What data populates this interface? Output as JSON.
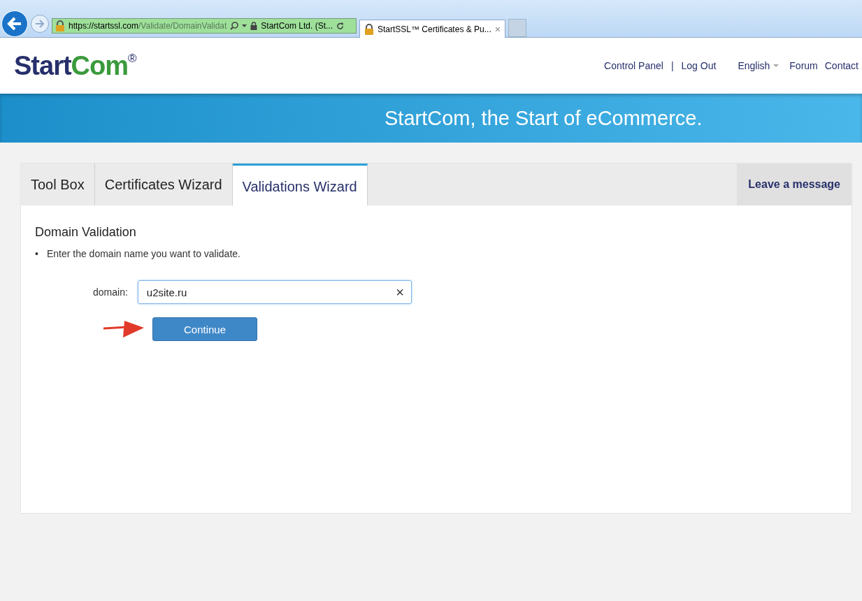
{
  "browser": {
    "url_host": "https://startssl.com",
    "url_path": "/Validate/DomainValidat",
    "site_identity": "StartCom Ltd. (St...",
    "tabs": [
      {
        "title": "StartSSL™ Certificates & Pu...",
        "selected": true,
        "close": "×"
      }
    ]
  },
  "header": {
    "logo": {
      "first": "Start",
      "second": "Com",
      "mark": "®"
    },
    "nav": [
      {
        "kind": "link",
        "label": "Control Panel"
      },
      {
        "kind": "separator",
        "label": "|"
      },
      {
        "kind": "link",
        "label": "Log Out"
      },
      {
        "kind": "dropdown",
        "label": "English"
      },
      {
        "kind": "link",
        "label": "Forum"
      },
      {
        "kind": "link",
        "label": "Contact"
      }
    ]
  },
  "banner": {
    "slogan": "StartCom, the Start of eCommerce."
  },
  "tabs": [
    {
      "label": "Tool Box",
      "selected": false
    },
    {
      "label": "Certificates Wizard",
      "selected": false
    },
    {
      "label": "Validations Wizard",
      "selected": true
    }
  ],
  "leave_message": "Leave a message",
  "form": {
    "title": "Domain Validation",
    "bullet": "•",
    "instruction": "Enter the domain name you want to validate.",
    "field_label": "domain:",
    "value": "u2site.ru",
    "clear": "×",
    "button": "Continue"
  }
}
